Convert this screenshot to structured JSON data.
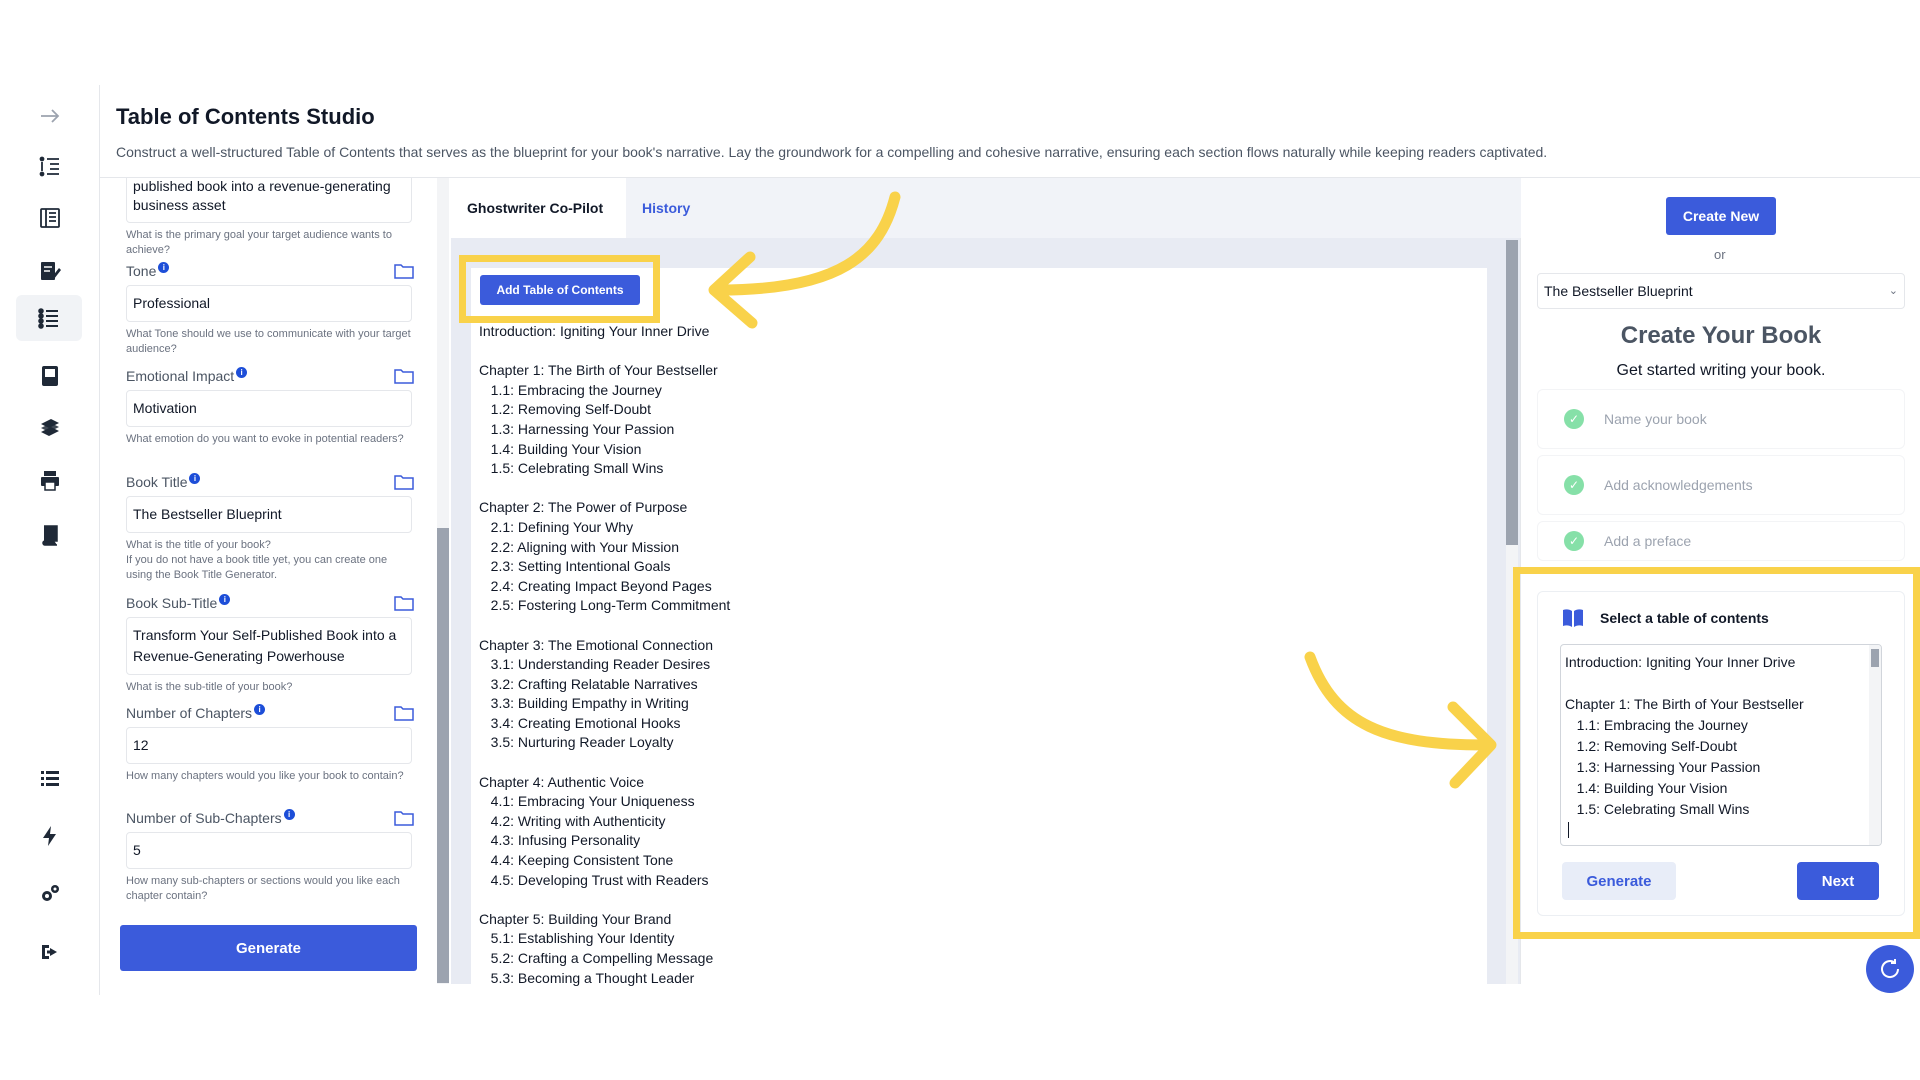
{
  "header": {
    "title": "Table of Contents Studio",
    "description": "Construct a well-structured Table of Contents that serves as the blueprint for your book's narrative. Lay the groundwork for a compelling and cohesive narrative, ensuring each section flows naturally while keeping readers captivated."
  },
  "sidebar": {
    "icons": [
      "expand-arrow-icon",
      "outline-list-icon",
      "chapters-icon",
      "edit-document-icon",
      "table-of-contents-icon",
      "notebook-icon",
      "books-stack-icon",
      "printer-icon",
      "book-icon",
      "list-icon",
      "lightning-icon",
      "settings-icon",
      "logout-icon"
    ],
    "active": "table-of-contents-icon"
  },
  "form": {
    "goal_value": "published book into a revenue-generating business asset",
    "goal_help": "What is the primary goal your target audience wants to achieve?",
    "tone_label": "Tone",
    "tone_value": "Professional",
    "tone_help": "What Tone should we use to communicate with your target audience?",
    "emotion_label": "Emotional Impact",
    "emotion_value": "Motivation",
    "emotion_help": "What emotion do you want to evoke in potential readers?",
    "book_title_label": "Book Title",
    "book_title_value": "The Bestseller Blueprint",
    "book_title_help": "What is the title of your book?\nIf you do not have a book title yet, you can create one using the Book Title Generator.",
    "subtitle_label": "Book Sub-Title",
    "subtitle_value": "Transform Your Self-Published Book into a Revenue-Generating Powerhouse",
    "subtitle_help": "What is the sub-title of your book?",
    "chapters_label": "Number of Chapters",
    "chapters_value": "12",
    "chapters_help": "How many chapters would you like your book to contain?",
    "subchapters_label": "Number of Sub-Chapters",
    "subchapters_value": "5",
    "subchapters_help": "How many sub-chapters or sections would you like each chapter contain?",
    "generate_label": "Generate"
  },
  "middle": {
    "tab_copilot": "Ghostwriter Co-Pilot",
    "tab_history": "History",
    "add_toc_label": "Add Table of Contents",
    "toc_text": "Introduction: Igniting Your Inner Drive\n\nChapter 1: The Birth of Your Bestseller\n   1.1: Embracing the Journey\n   1.2: Removing Self-Doubt\n   1.3: Harnessing Your Passion\n   1.4: Building Your Vision\n   1.5: Celebrating Small Wins\n\nChapter 2: The Power of Purpose\n   2.1: Defining Your Why\n   2.2: Aligning with Your Mission\n   2.3: Setting Intentional Goals\n   2.4: Creating Impact Beyond Pages\n   2.5: Fostering Long-Term Commitment\n\nChapter 3: The Emotional Connection\n   3.1: Understanding Reader Desires\n   3.2: Crafting Relatable Narratives\n   3.3: Building Empathy in Writing\n   3.4: Creating Emotional Hooks\n   3.5: Nurturing Reader Loyalty\n\nChapter 4: Authentic Voice\n   4.1: Embracing Your Uniqueness\n   4.2: Writing with Authenticity\n   4.3: Infusing Personality\n   4.4: Keeping Consistent Tone\n   4.5: Developing Trust with Readers\n\nChapter 5: Building Your Brand\n   5.1: Establishing Your Identity\n   5.2: Crafting a Compelling Message\n   5.3: Becoming a Thought Leader"
  },
  "right": {
    "create_new_label": "Create New",
    "or_label": "or",
    "book_select_value": "The Bestseller Blueprint",
    "title": "Create Your Book",
    "subtitle": "Get started writing your book.",
    "steps": [
      "Name your book",
      "Add acknowledgements",
      "Add a preface"
    ],
    "card_title": "Select a table of contents",
    "card_toc_text": "Introduction: Igniting Your Inner Drive\n\nChapter 1: The Birth of Your Bestseller\n   1.1: Embracing the Journey\n   1.2: Removing Self-Doubt\n   1.3: Harnessing Your Passion\n   1.4: Building Your Vision\n   1.5: Celebrating Small Wins",
    "generate_label": "Generate",
    "next_label": "Next"
  },
  "colors": {
    "accent": "#3b5bdb",
    "highlight": "#f9d24a",
    "success": "#86e0a8"
  }
}
